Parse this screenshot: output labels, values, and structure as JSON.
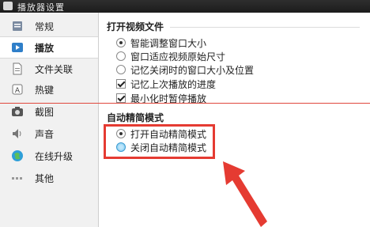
{
  "window": {
    "title": "播放器设置"
  },
  "sidebar": {
    "items": [
      {
        "label": "常规",
        "icon": "general-settings-icon"
      },
      {
        "label": "播放",
        "icon": "play-icon",
        "active": true
      },
      {
        "label": "文件关联",
        "icon": "file-association-icon"
      },
      {
        "label": "热键",
        "icon": "hotkey-icon"
      },
      {
        "label": "截图",
        "icon": "camera-icon"
      },
      {
        "label": "声音",
        "icon": "speaker-icon"
      },
      {
        "label": "在线升级",
        "icon": "online-update-icon"
      },
      {
        "label": "其他",
        "icon": "more-dots-icon"
      }
    ]
  },
  "open_video": {
    "title": "打开视频文件",
    "options": [
      {
        "label": "智能调整窗口大小",
        "type": "radio",
        "checked": true
      },
      {
        "label": "窗口适应视频原始尺寸",
        "type": "radio",
        "checked": false
      },
      {
        "label": "记忆关闭时的窗口大小及位置",
        "type": "radio",
        "checked": false
      },
      {
        "label": "记忆上次播放的进度",
        "type": "checkbox",
        "checked": true
      },
      {
        "label": "最小化时暂停播放",
        "type": "checkbox",
        "checked": true
      }
    ]
  },
  "auto_simple": {
    "title": "自动精简模式",
    "options": [
      {
        "label": "打开自动精简模式",
        "type": "radio",
        "checked": true
      },
      {
        "label": "关闭自动精简模式",
        "type": "radio",
        "checked": false
      }
    ]
  },
  "colors": {
    "annotation_red": "#e53b32",
    "sidebar_bg": "#f1f1f1"
  }
}
